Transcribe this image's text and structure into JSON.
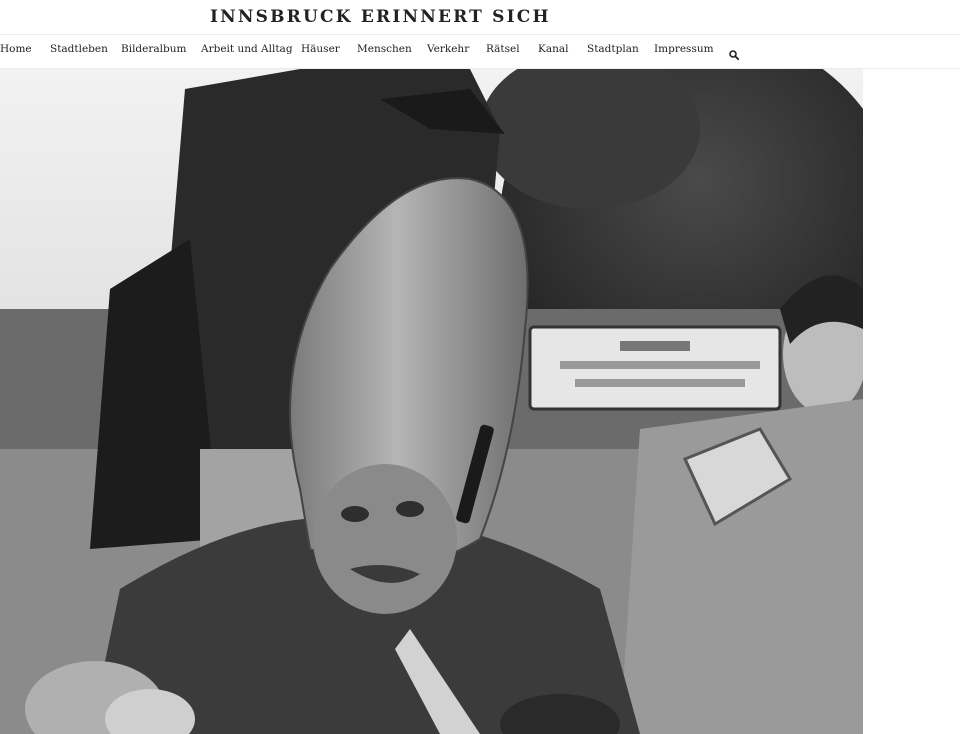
{
  "site": {
    "title": "INNSBRUCK ERINNERT SICH"
  },
  "nav": {
    "items": [
      {
        "label": "Home"
      },
      {
        "label": "Stadtleben"
      },
      {
        "label": "Bilderalbum"
      },
      {
        "label": "Arbeit und Alltag"
      },
      {
        "label": "Häuser"
      },
      {
        "label": "Menschen"
      },
      {
        "label": "Verkehr"
      },
      {
        "label": "Rätsel"
      },
      {
        "label": "Kanal"
      },
      {
        "label": "Stadtplan"
      },
      {
        "label": "Impressum"
      }
    ],
    "search_icon": "search-icon"
  },
  "colors": {
    "text": "#222222",
    "divider": "#ececec",
    "background": "#ffffff"
  }
}
